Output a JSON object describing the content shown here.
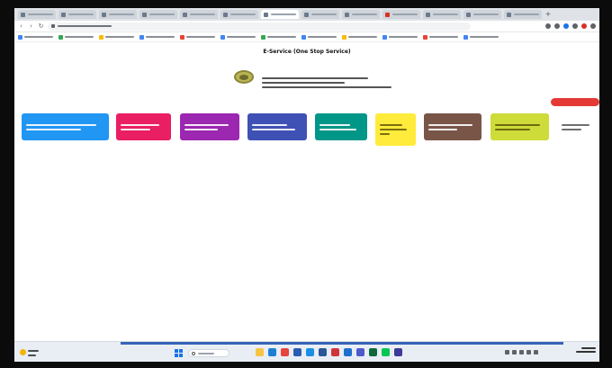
{
  "browser": {
    "tabs": [
      {
        "label": "",
        "active": false,
        "favicon": "site-favicon"
      },
      {
        "label": "",
        "active": false,
        "favicon": "site-favicon"
      },
      {
        "label": "",
        "active": false,
        "favicon": "site-favicon"
      },
      {
        "label": "",
        "active": false,
        "favicon": "site-favicon"
      },
      {
        "label": "",
        "active": false,
        "favicon": "site-favicon"
      },
      {
        "label": "",
        "active": false,
        "favicon": "site-favicon"
      },
      {
        "label": "",
        "active": true,
        "favicon": "site-favicon"
      },
      {
        "label": "",
        "active": false,
        "favicon": "site-favicon"
      },
      {
        "label": "",
        "active": false,
        "favicon": "site-favicon"
      },
      {
        "label": "",
        "active": false,
        "favicon": "youtube-favicon"
      },
      {
        "label": "",
        "active": false,
        "favicon": "site-favicon"
      },
      {
        "label": "",
        "active": false,
        "favicon": "site-favicon"
      },
      {
        "label": "",
        "active": false,
        "favicon": "site-favicon"
      }
    ],
    "address": {
      "url": ""
    },
    "bookmarks": [
      {
        "label": ""
      },
      {
        "label": ""
      },
      {
        "label": ""
      },
      {
        "label": ""
      },
      {
        "label": ""
      },
      {
        "label": ""
      },
      {
        "label": ""
      },
      {
        "label": ""
      },
      {
        "label": ""
      },
      {
        "label": ""
      },
      {
        "label": ""
      },
      {
        "label": ""
      }
    ]
  },
  "page": {
    "title": "E-Service (One Stop Service)",
    "org_name": "",
    "status_pill": ""
  },
  "service_cards": [
    {
      "label": "",
      "color": "#2196f3",
      "text_color": "light"
    },
    {
      "label": "",
      "color": "#e91e63",
      "text_color": "light"
    },
    {
      "label": "",
      "color": "#9c27b0",
      "text_color": "light"
    },
    {
      "label": "",
      "color": "#3f51b5",
      "text_color": "light"
    },
    {
      "label": "",
      "color": "#009688",
      "text_color": "light"
    },
    {
      "label": "",
      "color": "#ffeb3b",
      "text_color": "dark"
    },
    {
      "label": "",
      "color": "#795548",
      "text_color": "light"
    },
    {
      "label": "",
      "color": "#cddc39",
      "text_color": "dark"
    },
    {
      "label": "",
      "color": "#ffffff",
      "text_color": "plain"
    }
  ],
  "taskbar": {
    "search_placeholder": "",
    "apps": [
      "file-explorer",
      "edge",
      "chrome",
      "store",
      "mail",
      "word",
      "excel",
      "powerpoint",
      "teams",
      "photos",
      "line",
      "settings"
    ],
    "accent": "#3563b8"
  },
  "colors": {
    "page_bg": "#ffffff",
    "status_pill": "#e53935",
    "logo": "#b9b454"
  }
}
